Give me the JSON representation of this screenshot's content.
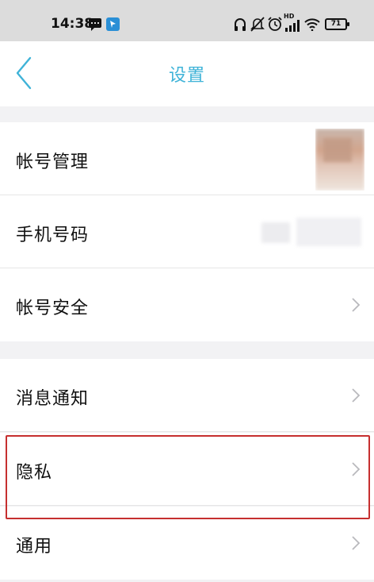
{
  "status_bar": {
    "time": "14:38",
    "battery": "71",
    "network_tag": "HD",
    "icons": [
      "message-icon",
      "app-notification-icon",
      "headphones-icon",
      "mute-icon",
      "alarm-icon",
      "signal-icon",
      "wifi-icon",
      "battery-icon"
    ]
  },
  "nav": {
    "title": "设置",
    "back_icon": "chevron-left-icon"
  },
  "rows": [
    {
      "label": "帐号管理",
      "trailing": "avatar"
    },
    {
      "label": "手机号码",
      "trailing": "masked-value"
    },
    {
      "label": "帐号安全",
      "trailing": "chevron-right-icon"
    },
    {
      "label": "消息通知",
      "trailing": "chevron-right-icon"
    },
    {
      "label": "隐私",
      "trailing": "chevron-right-icon",
      "highlighted": true
    },
    {
      "label": "通用",
      "trailing": "chevron-right-icon"
    }
  ],
  "colors": {
    "accent": "#3fb3d8",
    "highlight": "#c62f2f",
    "background": "#f2f2f4"
  }
}
